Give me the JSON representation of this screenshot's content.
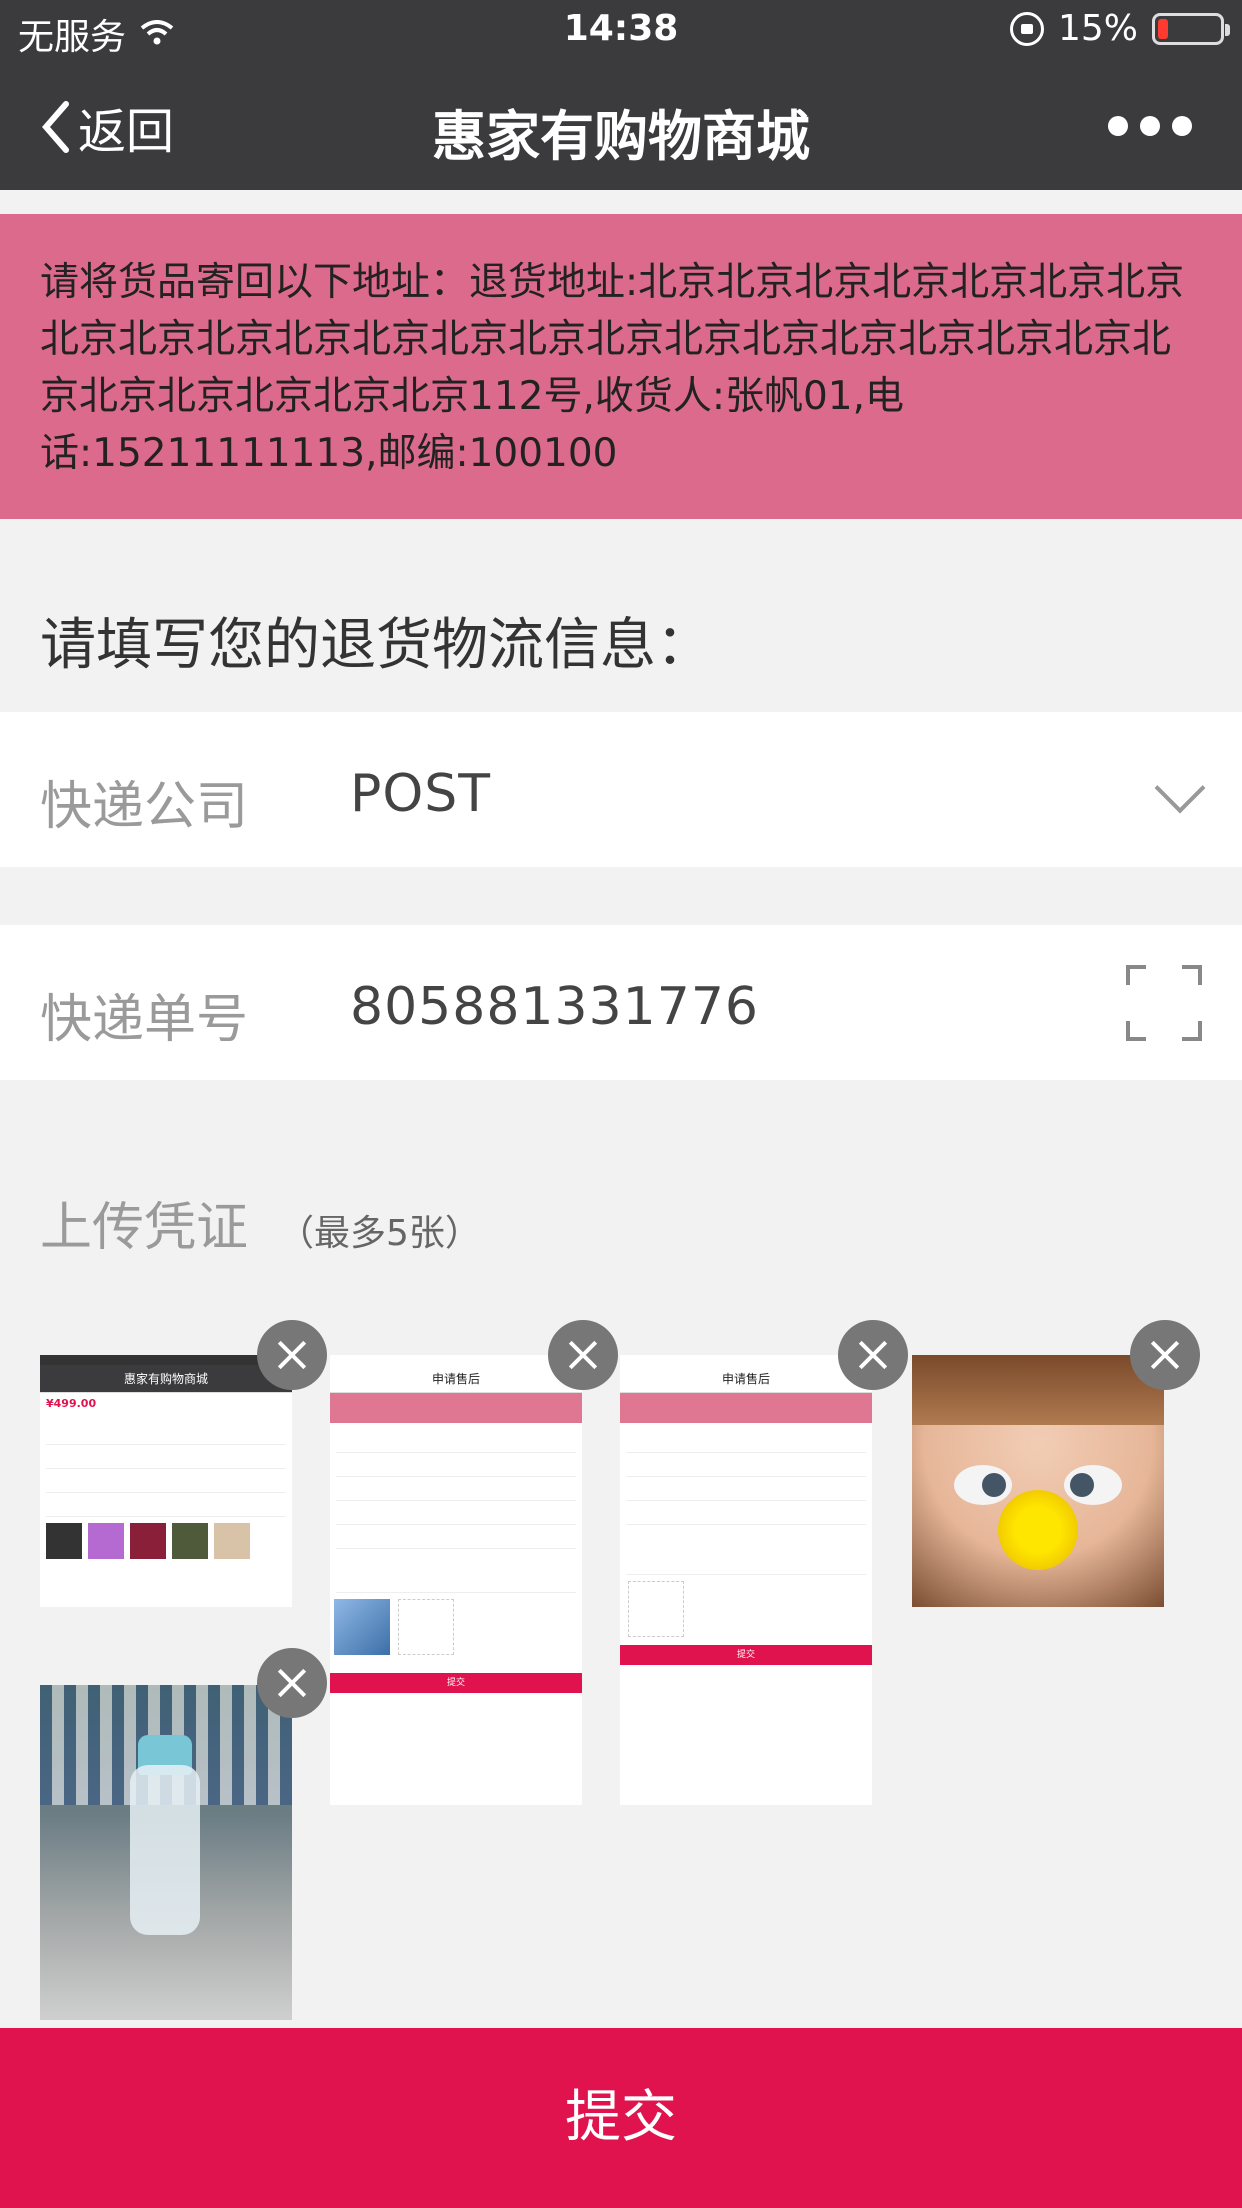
{
  "status_bar": {
    "carrier": "无服务",
    "time": "14:38",
    "battery": "15%",
    "battery_level": 0.15
  },
  "nav": {
    "back_label": "返回",
    "title": "惠家有购物商城"
  },
  "notice": {
    "text": "请将货品寄回以下地址：退货地址:北京北京北京北京北京北京北京北京北京北京北京北京北京北京北京北京北京北京北京北京北京北京北京北京北京北京北京112号,收货人:张帆01,电话:15211111113,邮编:100100"
  },
  "form": {
    "heading": "请填写您的退货物流信息：",
    "courier_label": "快递公司",
    "courier_value": "POST",
    "tracking_label": "快递单号",
    "tracking_value": "805881331776"
  },
  "upload": {
    "title": "上传凭证",
    "hint": "（最多5张）"
  },
  "thumbnails": {
    "t1_title": "惠家有购物商城",
    "t2_title": "申请售后",
    "t3_title": "申请售后",
    "mini_submit": "提交"
  },
  "submit_label": "提交",
  "colors": {
    "nav_bg": "#3b3b3d",
    "notice_bg": "#dc6a8c",
    "accent": "#e0134e"
  }
}
